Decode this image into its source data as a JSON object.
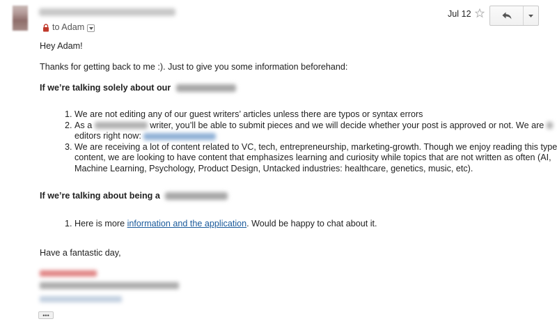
{
  "header": {
    "to_label": "to Adam",
    "date": "Jul 12"
  },
  "email": {
    "greeting": "Hey Adam!",
    "intro": "Thanks for getting back to me :). Just to give you some information beforehand:",
    "section1_heading": "If we’re talking solely about our",
    "list1": [
      "We are not editing any of our guest writers’ articles unless there are typos or syntax errors",
      "As a",
      "writer, you’ll be able to submit pieces and we will decide whether your post is approved or not. We are",
      "editors right now:",
      "We are receiving a lot of content related to VC, tech, entrepreneurship, marketing-growth. Though we enjoy reading this type of content, we are looking to have content that emphasizes learning and curiosity while topics that are not written as often (AI, Machine Learning, Psychology, Product Design, Untacked industries: healthcare, genetics, music, etc)."
    ],
    "section2_heading": "If we’re talking about being a",
    "list2_prefix": "Here is more",
    "list2_link": "information and the application",
    "list2_suffix": ". Would be happy to chat about it.",
    "closing": "Have a fantastic day,"
  },
  "colors": {
    "link": "#1a5a9b",
    "signature_red": "#d65a5a"
  },
  "icons": [
    "lock-icon",
    "chevron-down-icon",
    "star-icon",
    "reply-icon",
    "more-options-icon",
    "ellipsis-icon"
  ]
}
